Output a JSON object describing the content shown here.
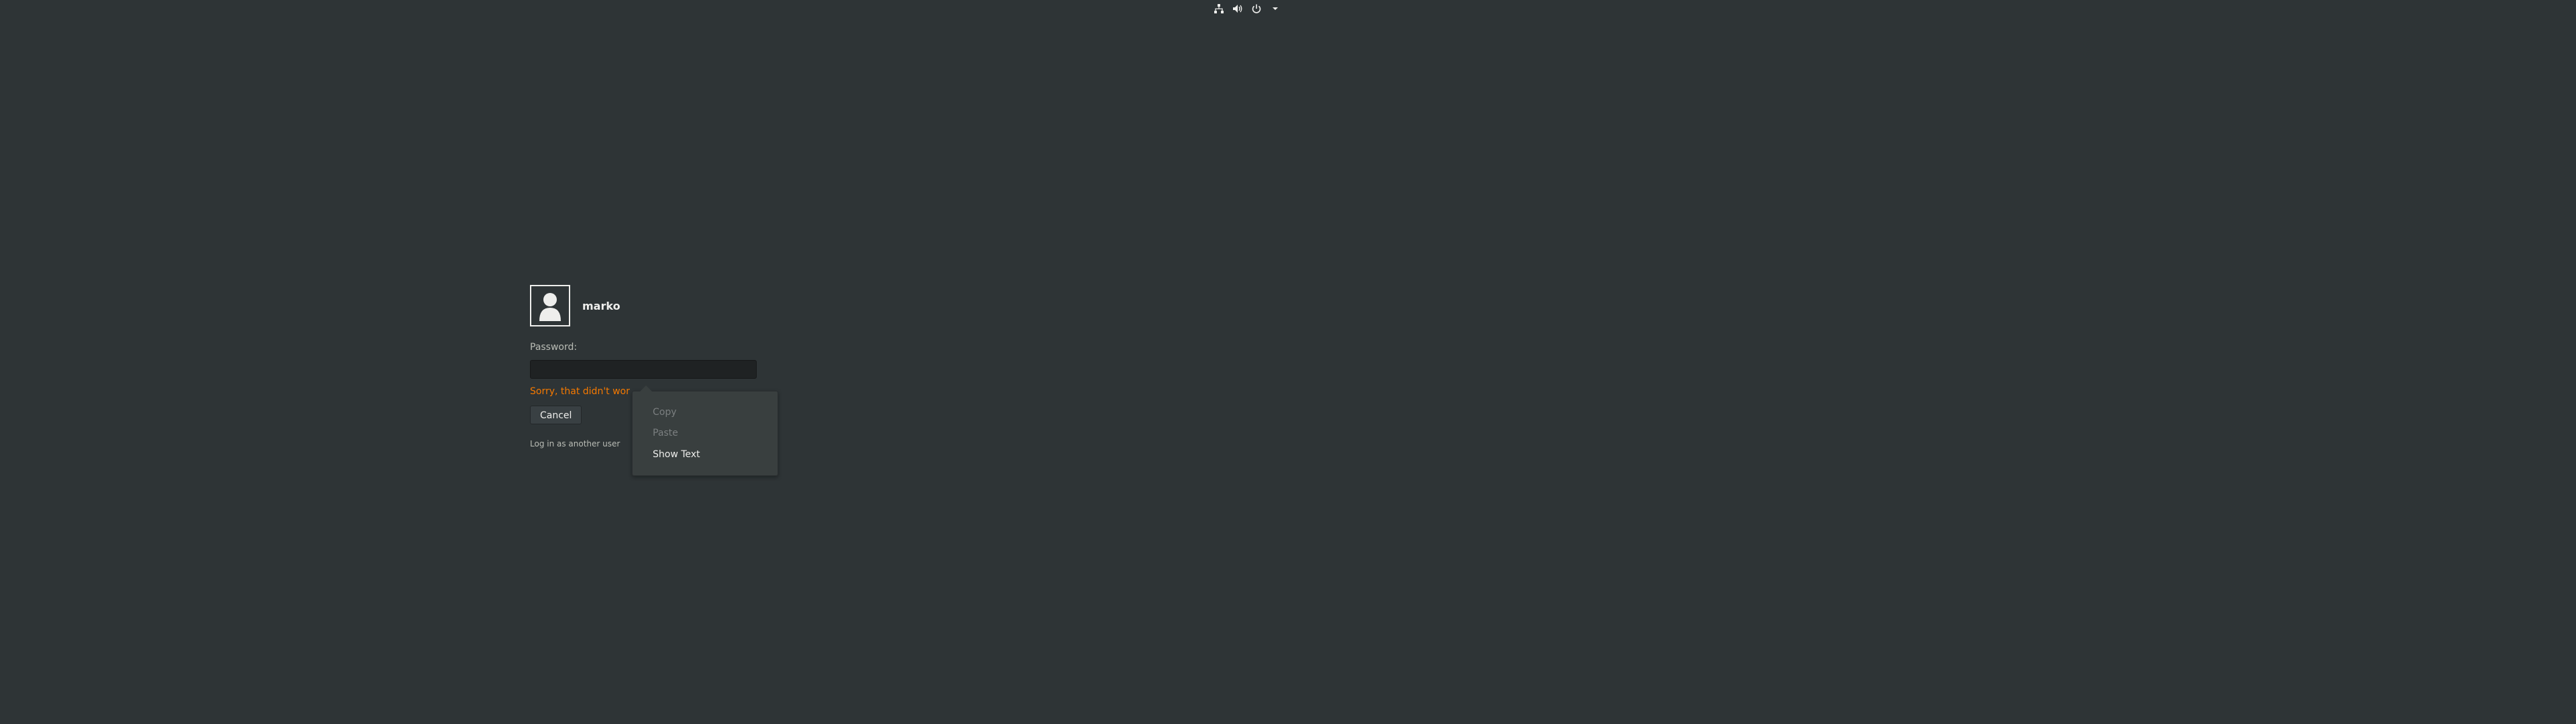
{
  "top_panel": {
    "icons": [
      "network-wired-icon",
      "volume-icon",
      "power-icon",
      "menu-arrow-down-icon"
    ]
  },
  "login": {
    "username": "marko",
    "password_label": "Password:",
    "password_value": "",
    "error_message": "Sorry, that didn't work. Please try again.",
    "cancel_label": "Cancel",
    "other_user_link": "Log in as another user"
  },
  "context_menu": {
    "items": [
      {
        "label": "Copy",
        "enabled": false
      },
      {
        "label": "Paste",
        "enabled": false
      },
      {
        "label": "Show Text",
        "enabled": true
      }
    ]
  },
  "colors": {
    "background": "#2e3436",
    "error": "#f57900",
    "menu_background": "#393f3f"
  }
}
